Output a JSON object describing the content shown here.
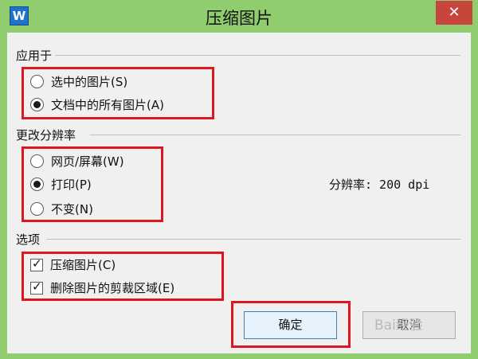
{
  "window": {
    "app_icon_label": "W",
    "title": "压缩图片",
    "close_glyph": "✕"
  },
  "apply_to": {
    "label": "应用于",
    "options": [
      {
        "label": "选中的图片(S)",
        "selected": false
      },
      {
        "label": "文档中的所有图片(A)",
        "selected": true
      }
    ]
  },
  "resolution": {
    "label": "更改分辨率",
    "options": [
      {
        "label": "网页/屏幕(W)",
        "selected": false
      },
      {
        "label": "打印(P)",
        "selected": true
      },
      {
        "label": "不变(N)",
        "selected": false
      }
    ],
    "dpi_text": "分辨率: 200 dpi"
  },
  "options": {
    "label": "选项",
    "items": [
      {
        "label": "压缩图片(C)",
        "checked": true
      },
      {
        "label": "删除图片的剪裁区域(E)",
        "checked": true
      }
    ]
  },
  "buttons": {
    "ok": "确定",
    "cancel": "取消"
  },
  "watermark": "Bai经验",
  "colors": {
    "title_bar": "#8fcd6e",
    "close_button": "#c7453c",
    "highlight_box": "#e0161f",
    "dialog_bg": "#f0f0f0"
  }
}
